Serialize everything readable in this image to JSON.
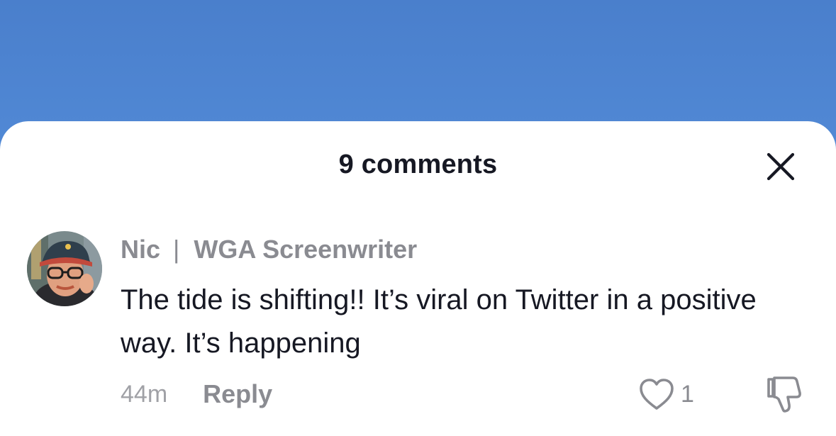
{
  "sheet": {
    "title": "9 comments"
  },
  "comment": {
    "author": "Nic",
    "separator": "|",
    "author_tagline": "WGA Screenwriter",
    "text": "The tide is shifting!! It’s viral on Twitter in a positive way. It’s happening",
    "time": "44m",
    "reply_label": "Reply",
    "like_count": "1"
  },
  "icons": {
    "close": "close-icon",
    "like": "heart-outline-icon",
    "dislike": "thumbs-down-outline-icon"
  },
  "colors": {
    "background_top": "#4a7fcc",
    "background_bottom": "#5b95e0",
    "sheet": "#ffffff",
    "primary_text": "#161823",
    "secondary_text": "#8a8b91"
  }
}
